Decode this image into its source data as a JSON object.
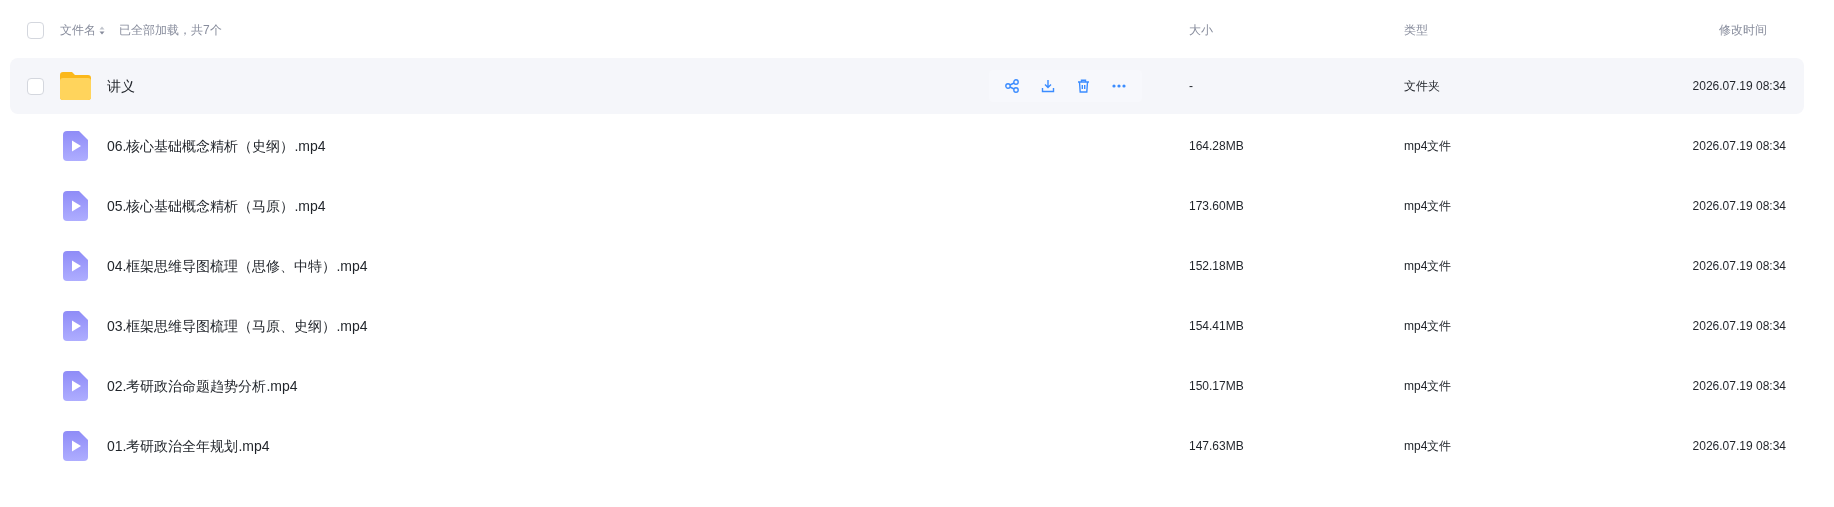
{
  "header": {
    "select_all": {
      "checked": false
    },
    "columns": {
      "name": "文件名",
      "status": "已全部加载，共7个",
      "size": "大小",
      "type": "类型",
      "modified": "修改时间"
    }
  },
  "rows": [
    {
      "kind": "folder",
      "name": "讲义",
      "size": "-",
      "type": "文件夹",
      "modified": "2026.07.19 08:34",
      "hovered": true,
      "checked": false
    },
    {
      "kind": "video",
      "name": "06.核心基础概念精析（史纲）.mp4",
      "size": "164.28MB",
      "type": "mp4文件",
      "modified": "2026.07.19 08:34",
      "hovered": false
    },
    {
      "kind": "video",
      "name": "05.核心基础概念精析（马原）.mp4",
      "size": "173.60MB",
      "type": "mp4文件",
      "modified": "2026.07.19 08:34",
      "hovered": false
    },
    {
      "kind": "video",
      "name": "04.框架思维导图梳理（思修、中特）.mp4",
      "size": "152.18MB",
      "type": "mp4文件",
      "modified": "2026.07.19 08:34",
      "hovered": false
    },
    {
      "kind": "video",
      "name": "03.框架思维导图梳理（马原、史纲）.mp4",
      "size": "154.41MB",
      "type": "mp4文件",
      "modified": "2026.07.19 08:34",
      "hovered": false
    },
    {
      "kind": "video",
      "name": "02.考研政治命题趋势分析.mp4",
      "size": "150.17MB",
      "type": "mp4文件",
      "modified": "2026.07.19 08:34",
      "hovered": false
    },
    {
      "kind": "video",
      "name": "01.考研政治全年规划.mp4",
      "size": "147.63MB",
      "type": "mp4文件",
      "modified": "2026.07.19 08:34",
      "hovered": false
    }
  ]
}
